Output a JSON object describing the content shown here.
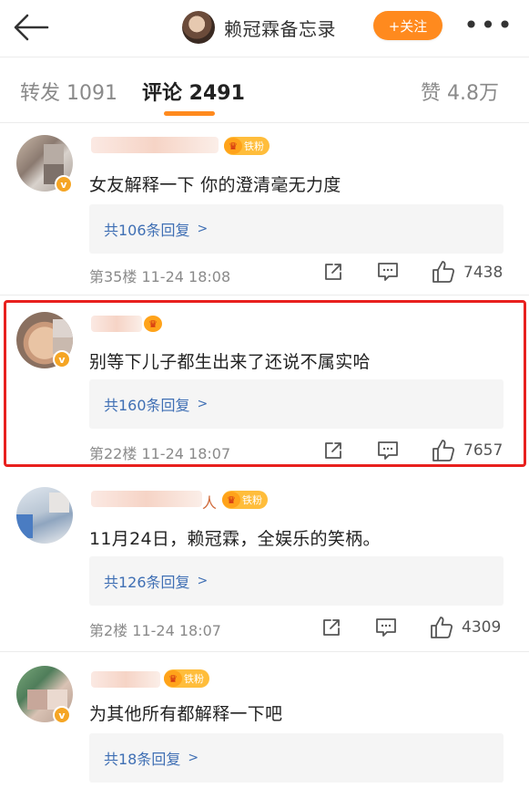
{
  "header": {
    "title": "赖冠霖备忘录",
    "follow_label": "+关注",
    "more_label": "•••"
  },
  "tabs": [
    {
      "label": "转发 1091"
    },
    {
      "label": "评论 2491"
    },
    {
      "label": "赞 4.8万"
    }
  ],
  "colors": {
    "accent": "#ff8a1e",
    "link": "#3f6fb4",
    "highlight": "#e8201e"
  },
  "comments": [
    {
      "badge": "铁粉",
      "text": "女友解释一下 你的澄清毫无力度",
      "reply": "共106条回复",
      "meta": "第35楼 11-24 18:08",
      "likes": "7438"
    },
    {
      "badge": "",
      "text": "别等下儿子都生出来了还说不属实哈",
      "reply": "共160条回复",
      "meta": "第22楼 11-24 18:07",
      "likes": "7657"
    },
    {
      "badge": "铁粉",
      "name_suffix": "人",
      "text": "11月24日，赖冠霖，全娱乐的笑柄。",
      "reply": "共126条回复",
      "meta": "第2楼 11-24 18:07",
      "likes": "4309"
    },
    {
      "badge": "铁粉",
      "text": "为其他所有都解释一下吧",
      "reply": "共18条回复"
    }
  ]
}
